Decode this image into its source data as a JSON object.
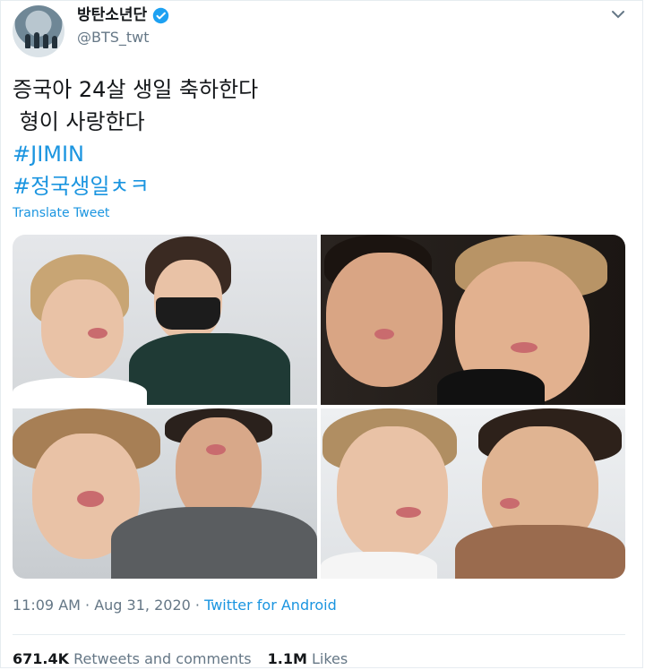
{
  "tweet": {
    "display_name": "방탄소년단",
    "handle": "@BTS_twt",
    "verified": true,
    "text_lines": [
      "증국아 24살 생일 축하한다",
      " 형이 사랑한다"
    ],
    "hashtags": [
      "#JIMIN",
      "#정국생일ㅊㅋ"
    ],
    "translate_label": "Translate Tweet",
    "time": "11:09 AM",
    "date": "Aug 31, 2020",
    "source": "Twitter for Android",
    "retweets_count": "671.4K",
    "retweets_label": "Retweets and comments",
    "likes_count": "1.1M",
    "likes_label": "Likes"
  },
  "icons": {
    "verified": "verified-badge-icon",
    "menu": "chevron-down-icon"
  },
  "colors": {
    "link": "#1b95e0",
    "secondary_text": "#657786",
    "primary_text": "#14171a"
  }
}
